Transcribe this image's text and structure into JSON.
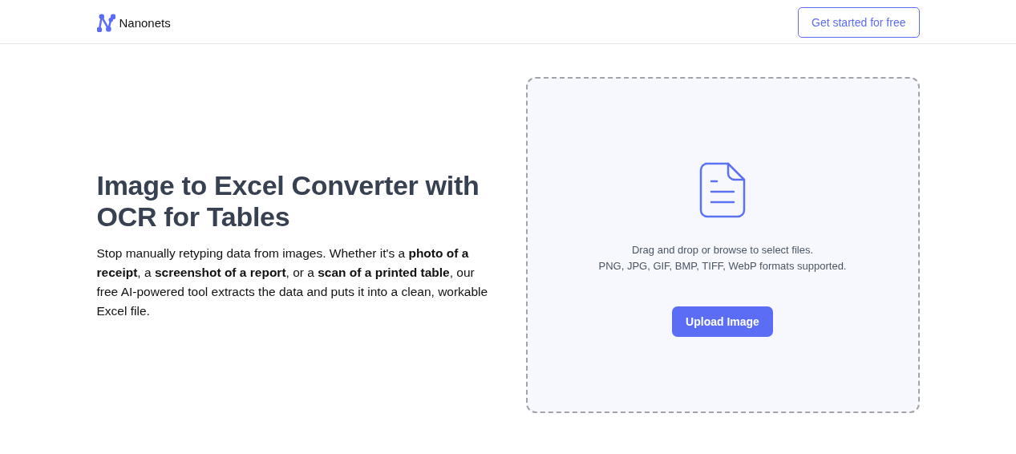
{
  "header": {
    "brand": "Nanonets",
    "cta": "Get started for free"
  },
  "hero": {
    "title": "Image to Excel Converter with OCR for Tables",
    "description": "Stop manually retyping data from images. Whether it's a **photo of a receipt**, a **screenshot of a report**, or a **scan of a printed table**, our free AI-powered tool extracts the data and puts it into a clean, workable Excel file."
  },
  "dropzone": {
    "instructions": "Drag and drop or browse to select files.",
    "formats": "PNG, JPG, GIF, BMP, TIFF, WebP formats supported.",
    "button": "Upload Image"
  }
}
